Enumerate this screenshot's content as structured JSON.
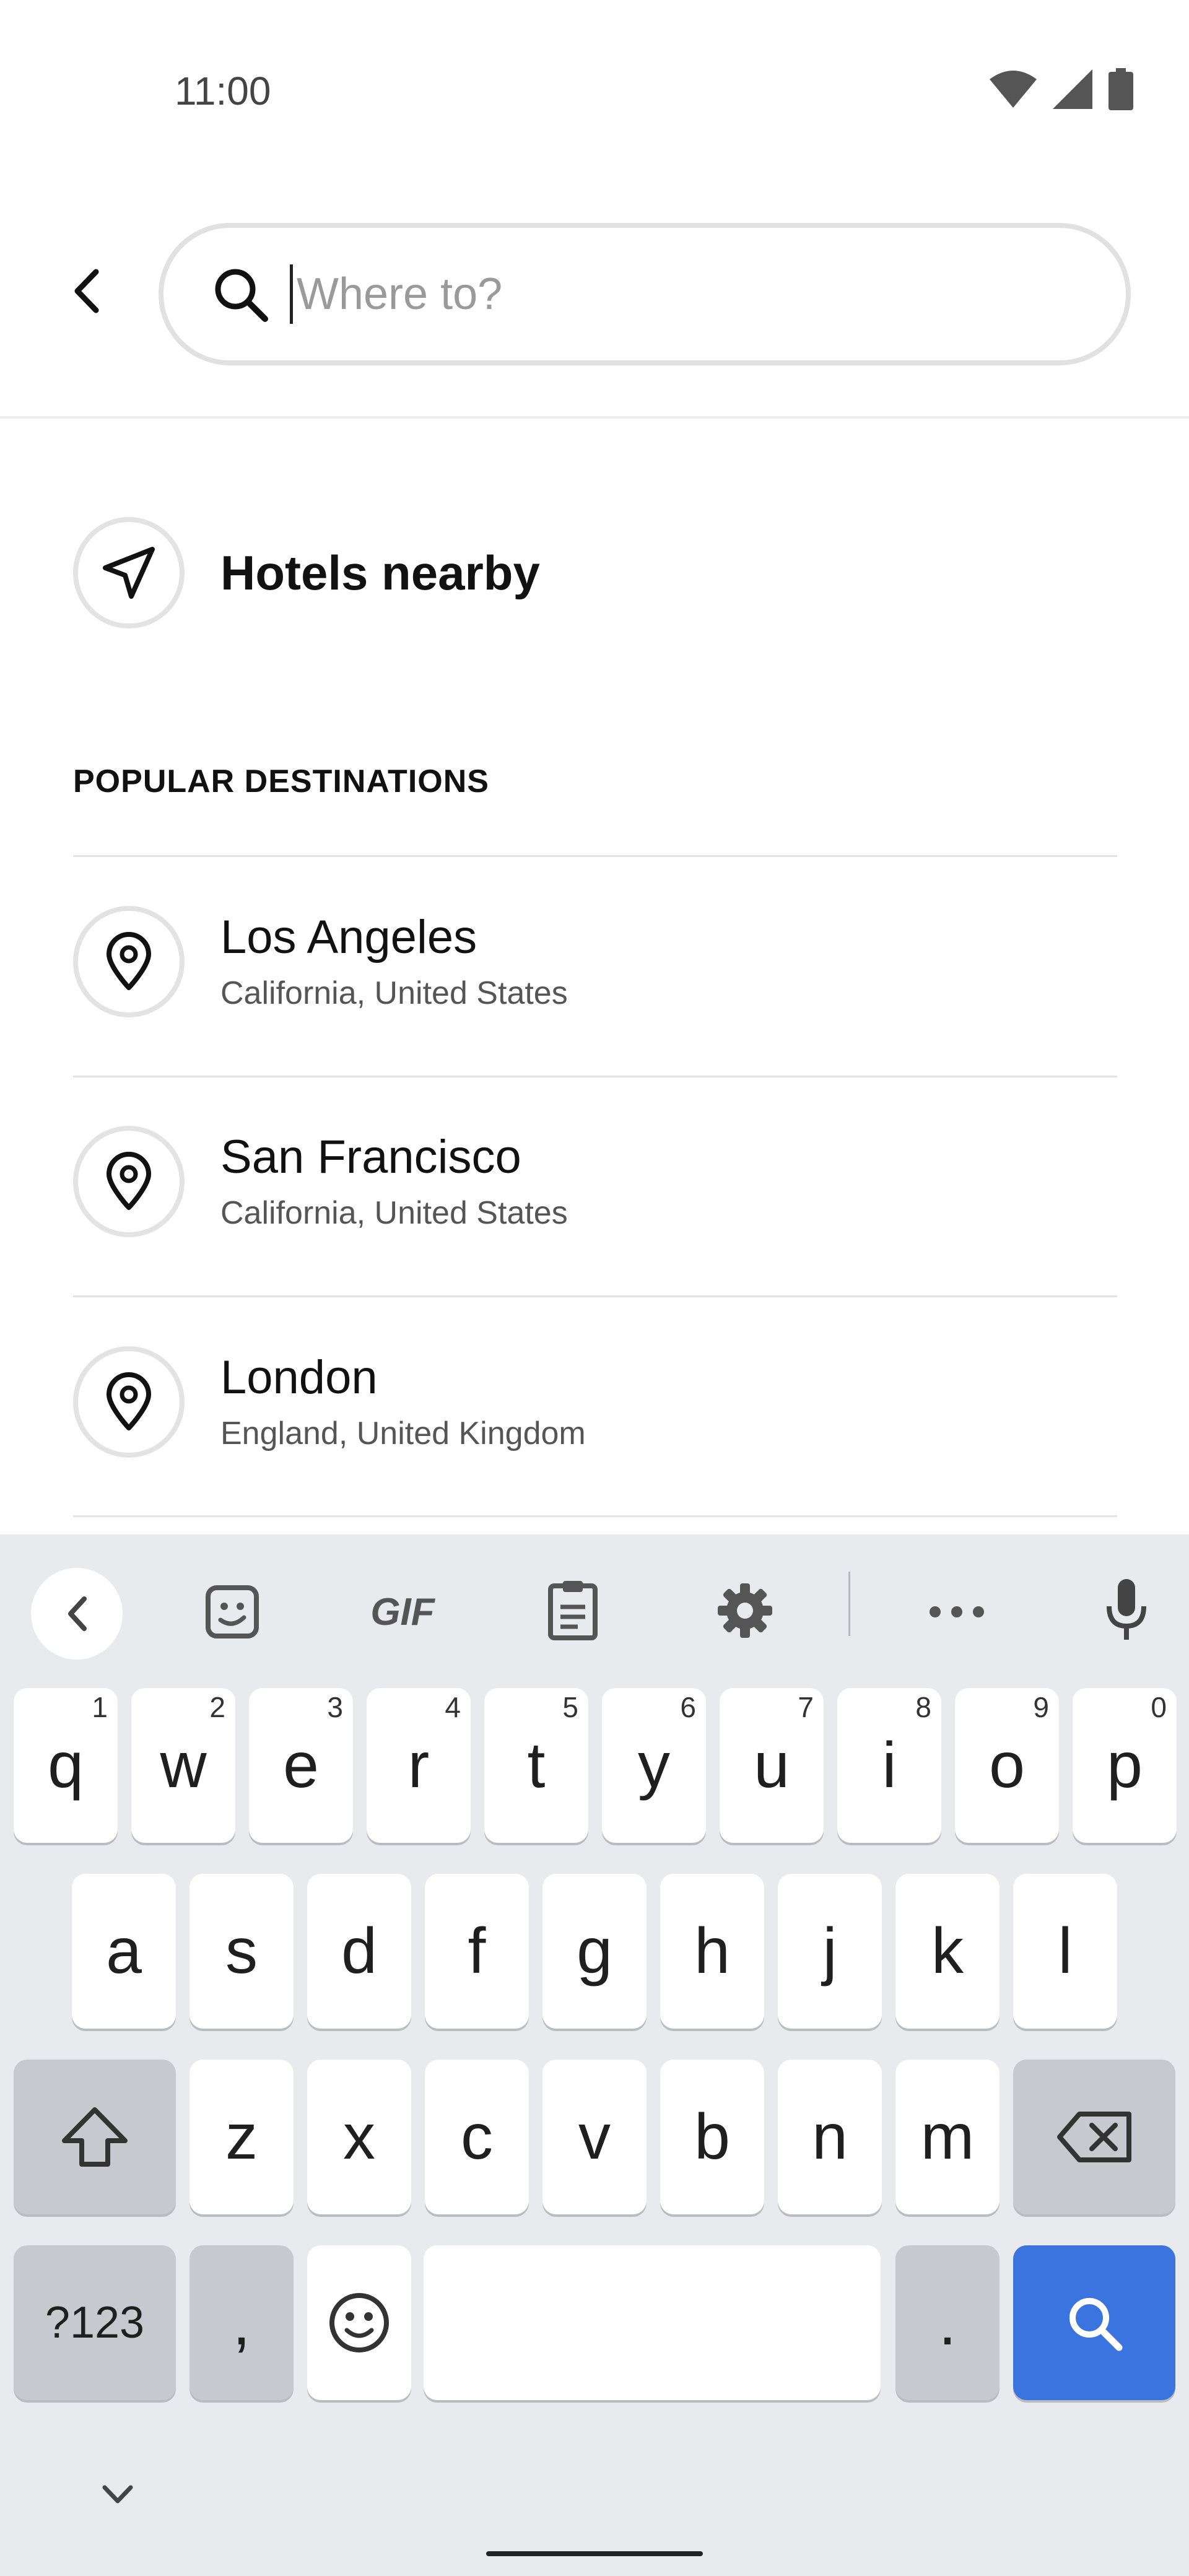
{
  "status_bar": {
    "time": "11:00",
    "icons": [
      "wifi-icon",
      "signal-icon",
      "battery-icon"
    ]
  },
  "search": {
    "placeholder": "Where to?",
    "value": ""
  },
  "nearby": {
    "label": "Hotels nearby"
  },
  "popular": {
    "title": "POPULAR DESTINATIONS",
    "items": [
      {
        "name": "Los Angeles",
        "region": "California, United States"
      },
      {
        "name": "San Francisco",
        "region": "California, United States"
      },
      {
        "name": "London",
        "region": "England, United Kingdom"
      }
    ]
  },
  "keyboard": {
    "toolbar": [
      "collapse-icon",
      "sticker-icon",
      "gif",
      "clipboard-icon",
      "settings-icon",
      "more-icon",
      "mic-icon"
    ],
    "gif_label": "GIF",
    "row1": [
      {
        "k": "q",
        "h": "1"
      },
      {
        "k": "w",
        "h": "2"
      },
      {
        "k": "e",
        "h": "3"
      },
      {
        "k": "r",
        "h": "4"
      },
      {
        "k": "t",
        "h": "5"
      },
      {
        "k": "y",
        "h": "6"
      },
      {
        "k": "u",
        "h": "7"
      },
      {
        "k": "i",
        "h": "8"
      },
      {
        "k": "o",
        "h": "9"
      },
      {
        "k": "p",
        "h": "0"
      }
    ],
    "row2": [
      "a",
      "s",
      "d",
      "f",
      "g",
      "h",
      "j",
      "k",
      "l"
    ],
    "row3": [
      "z",
      "x",
      "c",
      "v",
      "b",
      "n",
      "m"
    ],
    "sym_label": "?123",
    "comma": ",",
    "period": "."
  },
  "colors": {
    "accent": "#3b73df",
    "keyboard_bg": "#e8eaee"
  }
}
